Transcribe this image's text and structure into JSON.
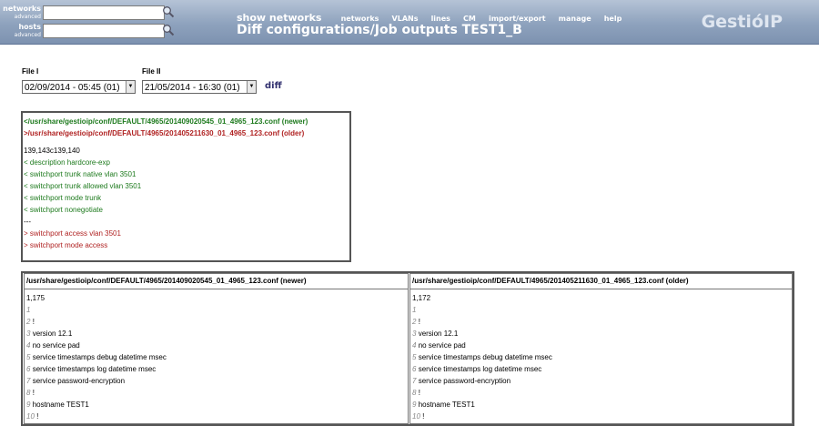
{
  "header": {
    "search": [
      {
        "label": "networks",
        "sub": "advanced",
        "value": ""
      },
      {
        "label": "hosts",
        "sub": "advanced",
        "value": ""
      }
    ],
    "show_networks": "show networks",
    "menu": [
      "networks",
      "VLANs",
      "lines",
      "CM",
      "import/export",
      "manage",
      "help"
    ],
    "page_title": "Diff configurations/Job outputs TEST1_B",
    "logo": "GestióIP"
  },
  "files": {
    "file1_label": "File I",
    "file2_label": "File II",
    "file1_value": "02/09/2014 - 05:45 (01)",
    "file2_value": "21/05/2014 - 16:30 (01)",
    "diff_label": "diff"
  },
  "diff": {
    "newer": "</usr/share/gestioip/conf/DEFAULT/4965/201409020545_01_4965_123.conf (newer)",
    "older": ">/usr/share/gestioip/conf/DEFAULT/4965/201405211630_01_4965_123.conf (older)",
    "range": "139,143c139,140",
    "removed": [
      "< description hardcore-exp",
      "< switchport trunk native vlan 3501",
      "< switchport trunk allowed vlan 3501",
      "< switchport mode trunk",
      "< switchport nonegotiate"
    ],
    "sep": "---",
    "added": [
      "> switchport access vlan 3501",
      "> switchport mode access"
    ]
  },
  "compare": {
    "left": {
      "header": "/usr/share/gestioip/conf/DEFAULT/4965/201409020545_01_4965_123.conf (newer)",
      "count": "1,175",
      "lines": [
        {
          "n": "1",
          "t": ""
        },
        {
          "n": "2",
          "t": "!"
        },
        {
          "n": "3",
          "t": "version 12.1"
        },
        {
          "n": "4",
          "t": "no service pad"
        },
        {
          "n": "5",
          "t": "service timestamps debug datetime msec"
        },
        {
          "n": "6",
          "t": "service timestamps log datetime msec"
        },
        {
          "n": "7",
          "t": "service password-encryption"
        },
        {
          "n": "8",
          "t": "!"
        },
        {
          "n": "9",
          "t": "hostname TEST1"
        },
        {
          "n": "10",
          "t": "!"
        }
      ]
    },
    "right": {
      "header": "/usr/share/gestioip/conf/DEFAULT/4965/201405211630_01_4965_123.conf (older)",
      "count": "1,172",
      "lines": [
        {
          "n": "1",
          "t": ""
        },
        {
          "n": "2",
          "t": "!"
        },
        {
          "n": "3",
          "t": "version 12.1"
        },
        {
          "n": "4",
          "t": "no service pad"
        },
        {
          "n": "5",
          "t": "service timestamps debug datetime msec"
        },
        {
          "n": "6",
          "t": "service timestamps log datetime msec"
        },
        {
          "n": "7",
          "t": "service password-encryption"
        },
        {
          "n": "8",
          "t": "!"
        },
        {
          "n": "9",
          "t": "hostname TEST1"
        },
        {
          "n": "10",
          "t": "!"
        }
      ]
    }
  }
}
